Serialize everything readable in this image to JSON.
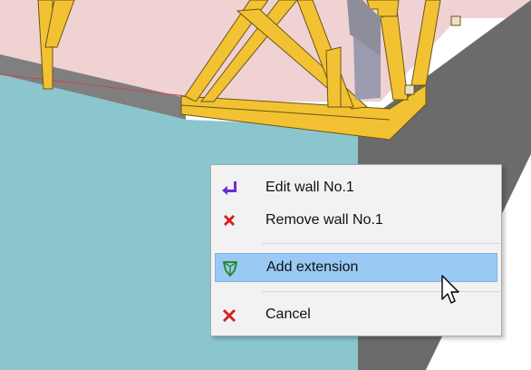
{
  "context_menu": {
    "items": [
      {
        "label": "Edit wall No.1",
        "icon": "edit-arrow-icon",
        "icon_color": "#6a2fd0"
      },
      {
        "label": "Remove wall No.1",
        "icon": "remove-x-icon",
        "icon_color": "#d71f1f"
      },
      {
        "label": "Add extension",
        "icon": "add-extension-icon",
        "icon_color": "#2f8a2f",
        "highlighted": true
      },
      {
        "label": "Cancel",
        "icon": "cancel-x-icon",
        "icon_color": "#d71f1f"
      }
    ]
  },
  "colors": {
    "menu_background": "#f2f2f2",
    "menu_highlight": "#99c9f4",
    "wall_face": "#8bc6cf",
    "roof_plane": "#f0d2d2",
    "timber": "#f2c233",
    "shadow_gray": "#6b6b6b"
  }
}
